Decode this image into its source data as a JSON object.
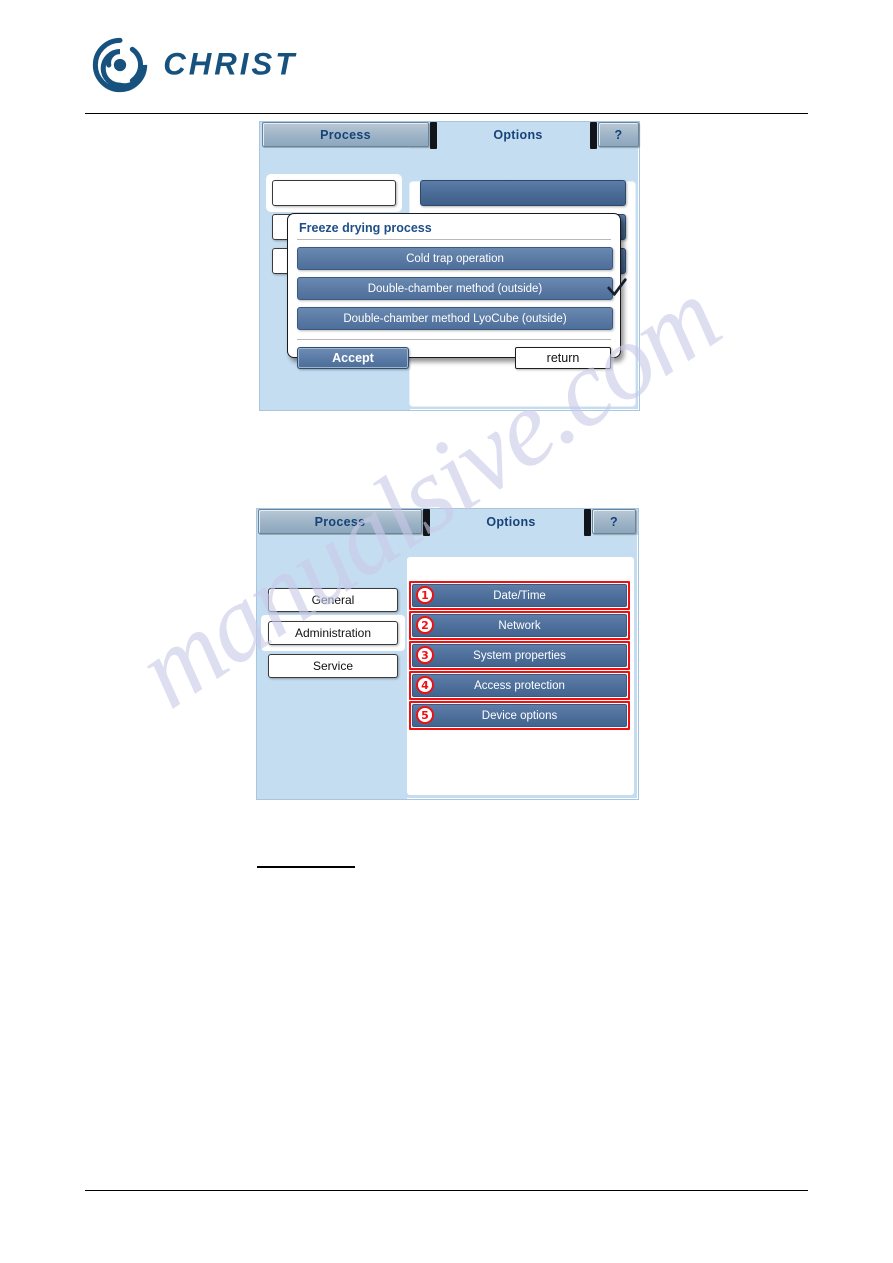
{
  "brand": {
    "name": "CHRIST",
    "logo_icon": "christ-spiral-logo-icon",
    "color": "#17527f"
  },
  "watermark": {
    "text": "manualsive.com"
  },
  "screenshots": [
    {
      "id": "freeze-drying-process-dialog",
      "tabs": [
        {
          "label": "Process",
          "state": "raised"
        },
        {
          "label": "Options",
          "state": "active"
        },
        {
          "label": "?",
          "state": "raised",
          "icon": "help-icon"
        }
      ],
      "dialog": {
        "title": "Freeze drying process",
        "options": [
          {
            "label": "Cold trap operation",
            "selected": false
          },
          {
            "label": "Double-chamber method (outside)",
            "selected": true,
            "check_icon": "checkmark-icon"
          },
          {
            "label": "Double-chamber method LyoCube (outside)",
            "selected": false
          }
        ],
        "accept_label": "Accept",
        "return_label": "return"
      }
    },
    {
      "id": "options-administration-screen",
      "tabs": [
        {
          "label": "Process",
          "state": "raised"
        },
        {
          "label": "Options",
          "state": "active"
        },
        {
          "label": "?",
          "state": "raised",
          "icon": "help-icon"
        }
      ],
      "nav": {
        "items": [
          {
            "label": "General",
            "selected": false
          },
          {
            "label": "Administration",
            "selected": true
          },
          {
            "label": "Service",
            "selected": false
          }
        ]
      },
      "options": [
        {
          "callout": "1",
          "label": "Date/Time"
        },
        {
          "callout": "2",
          "label": "Network"
        },
        {
          "callout": "3",
          "label": "System properties"
        },
        {
          "callout": "4",
          "label": "Access protection"
        },
        {
          "callout": "5",
          "label": "Device options"
        }
      ],
      "annotation_color": "#ee1111"
    }
  ]
}
